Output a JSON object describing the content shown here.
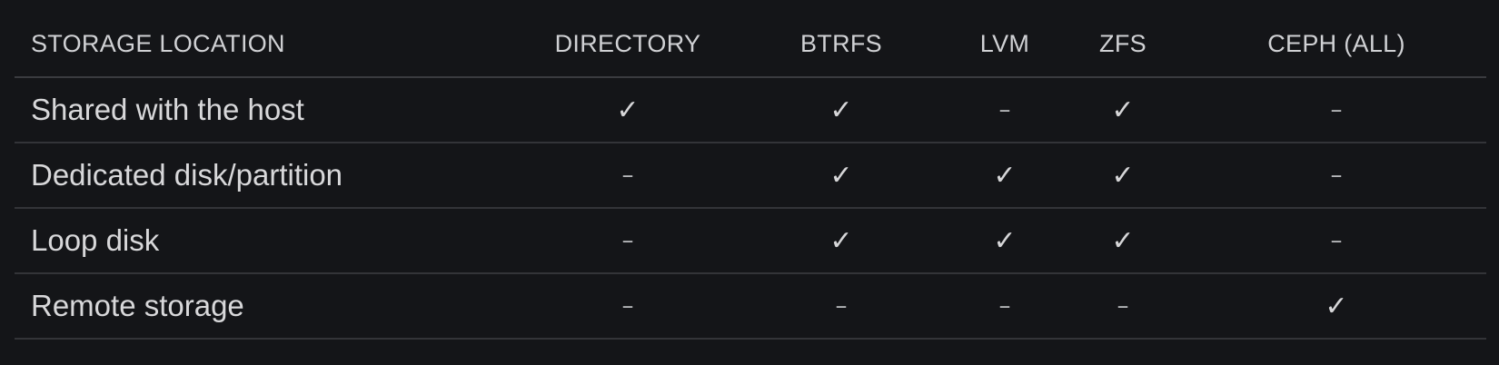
{
  "table": {
    "headers": [
      "STORAGE LOCATION",
      "DIRECTORY",
      "BTRFS",
      "LVM",
      "ZFS",
      "CEPH (ALL)"
    ],
    "rows": [
      {
        "label": "Shared with the host",
        "cells": [
          "✓",
          "✓",
          "–",
          "✓",
          "–"
        ]
      },
      {
        "label": "Dedicated disk/partition",
        "cells": [
          "–",
          "✓",
          "✓",
          "✓",
          "–"
        ]
      },
      {
        "label": "Loop disk",
        "cells": [
          "–",
          "✓",
          "✓",
          "✓",
          "–"
        ]
      },
      {
        "label": "Remote storage",
        "cells": [
          "–",
          "–",
          "–",
          "–",
          "✓"
        ]
      }
    ]
  },
  "colors": {
    "background": "#141518",
    "text": "#d8d8da",
    "divider": "#333438"
  },
  "icons": {
    "supported": "check-icon",
    "unsupported": "dash-icon"
  }
}
